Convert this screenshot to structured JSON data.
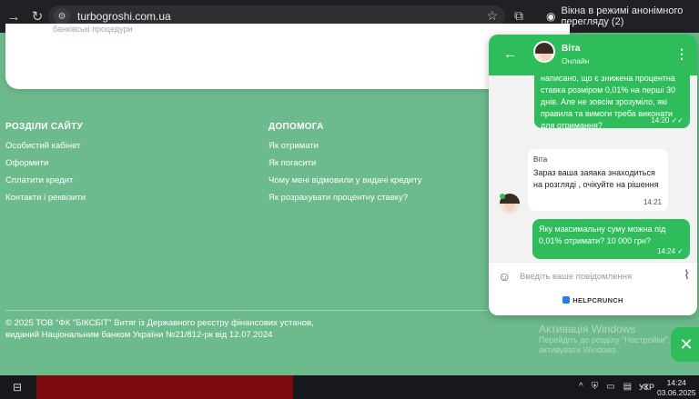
{
  "browser": {
    "url": "turbogroshi.com.ua",
    "incognito_label": "Вікна в режимі анонімного перегляду (2)",
    "icons": [
      "forward-icon",
      "reload-icon",
      "site-info-icon",
      "star-icon",
      "extension-icon",
      "incognito-icon"
    ]
  },
  "page": {
    "card_cut_text": "банківські процедури",
    "footer": {
      "col1": {
        "title": "РОЗДІЛИ САЙТУ",
        "links": [
          "Особистий кабінет",
          "Оформити",
          "Сплатити кредит",
          "Контакти і реквізити"
        ]
      },
      "col2": {
        "title": "ДОПОМОГА",
        "links": [
          "Як отримати",
          "Як погасити",
          "Чому мені відмовили у видачі кредиту",
          "Як розрахувати процентну ставку?"
        ]
      },
      "copyright_line1": "© 2025 ТОВ \"ФК \"БІКСБІТ\" Витяг із Державного реєстру фінансових установ,",
      "copyright_line2": "виданий Національним банком України №21/812-рк від 12.07.2024"
    }
  },
  "chat": {
    "agent_name": "Віта",
    "agent_status": "Онлайн",
    "messages": [
      {
        "direction": "out",
        "text": "написано, що є знижена процентна ставка розміром 0,01% на перші 30 днів. Але не зовсім зрозуміло, які правила та вимоги треба виконати для отримання?",
        "time": "14:20",
        "ticks": "✓✓"
      },
      {
        "direction": "in",
        "author": "Віта",
        "text": "Зараз ваша заяака знаходиться на розгляді , очікуйте на рішення",
        "time": "14:21"
      },
      {
        "direction": "out",
        "text": "Яку максимальну суму можна під 0,01% отримати? 10 000 грн?",
        "time": "14:24",
        "ticks": "✓"
      }
    ],
    "input_placeholder": "Введіть ваше повідомлення",
    "powered_by": "HELPCRUNCH"
  },
  "watermark": {
    "line1": "Активація Windows",
    "line2": "Перейдіть до розділу \"Настройки\", щоб",
    "line3": "активувати Windows."
  },
  "taskbar": {
    "lang": "УКР",
    "time": "14:24",
    "date": "03.06.2025"
  }
}
